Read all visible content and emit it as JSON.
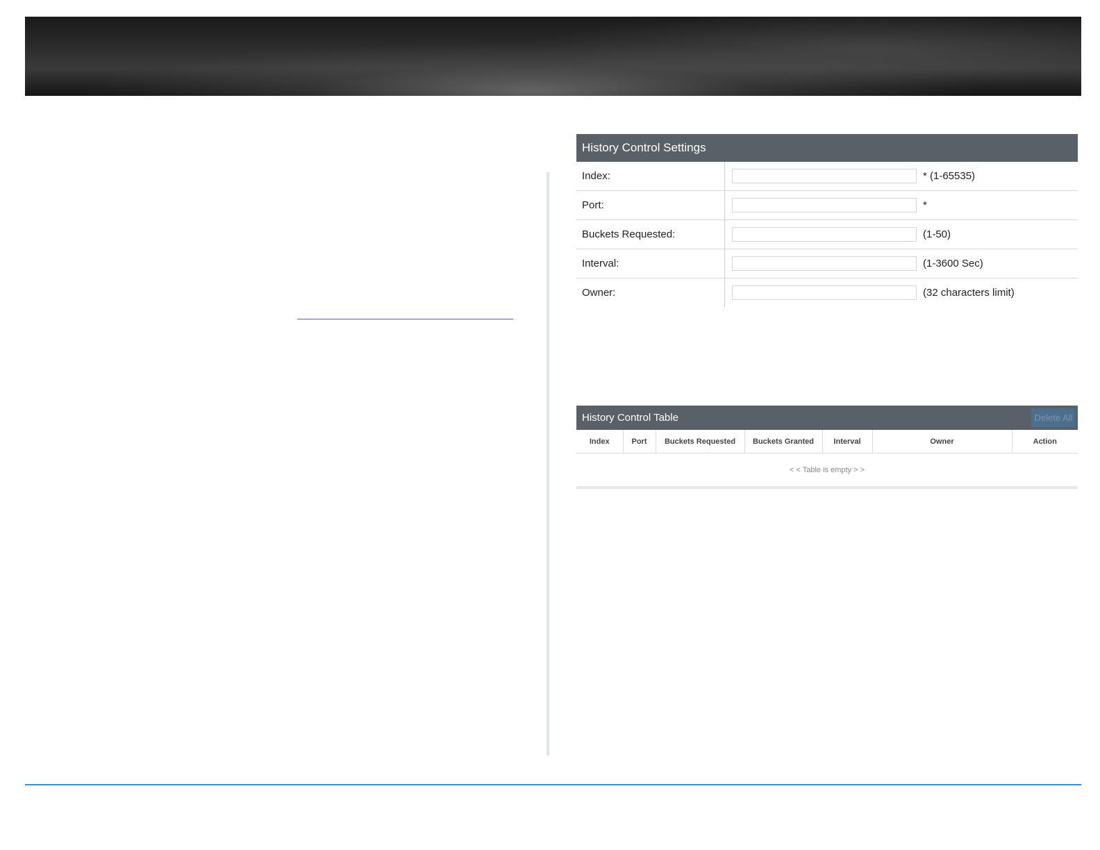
{
  "settings": {
    "title": "History Control Settings",
    "fields": [
      {
        "label": "Index:",
        "value": "",
        "hint": "* (1-65535)"
      },
      {
        "label": "Port:",
        "value": "",
        "hint": "*"
      },
      {
        "label": "Buckets Requested:",
        "value": "",
        "hint": "(1-50)"
      },
      {
        "label": "Interval:",
        "value": "",
        "hint": "(1-3600 Sec)"
      },
      {
        "label": "Owner:",
        "value": "",
        "hint": "(32 characters limit)"
      }
    ]
  },
  "table": {
    "title": "History Control Table",
    "delete_all_label": "Delete All",
    "columns": [
      "Index",
      "Port",
      "Buckets Requested",
      "Buckets Granted",
      "Interval",
      "Owner",
      "Action"
    ],
    "empty_message": "< < Table is empty > >"
  },
  "colors": {
    "panel_header": "#5a6068",
    "delete_button": "#4d6f8e",
    "footer_rule": "#4a86c8",
    "link_underline": "#5b5ea8"
  }
}
